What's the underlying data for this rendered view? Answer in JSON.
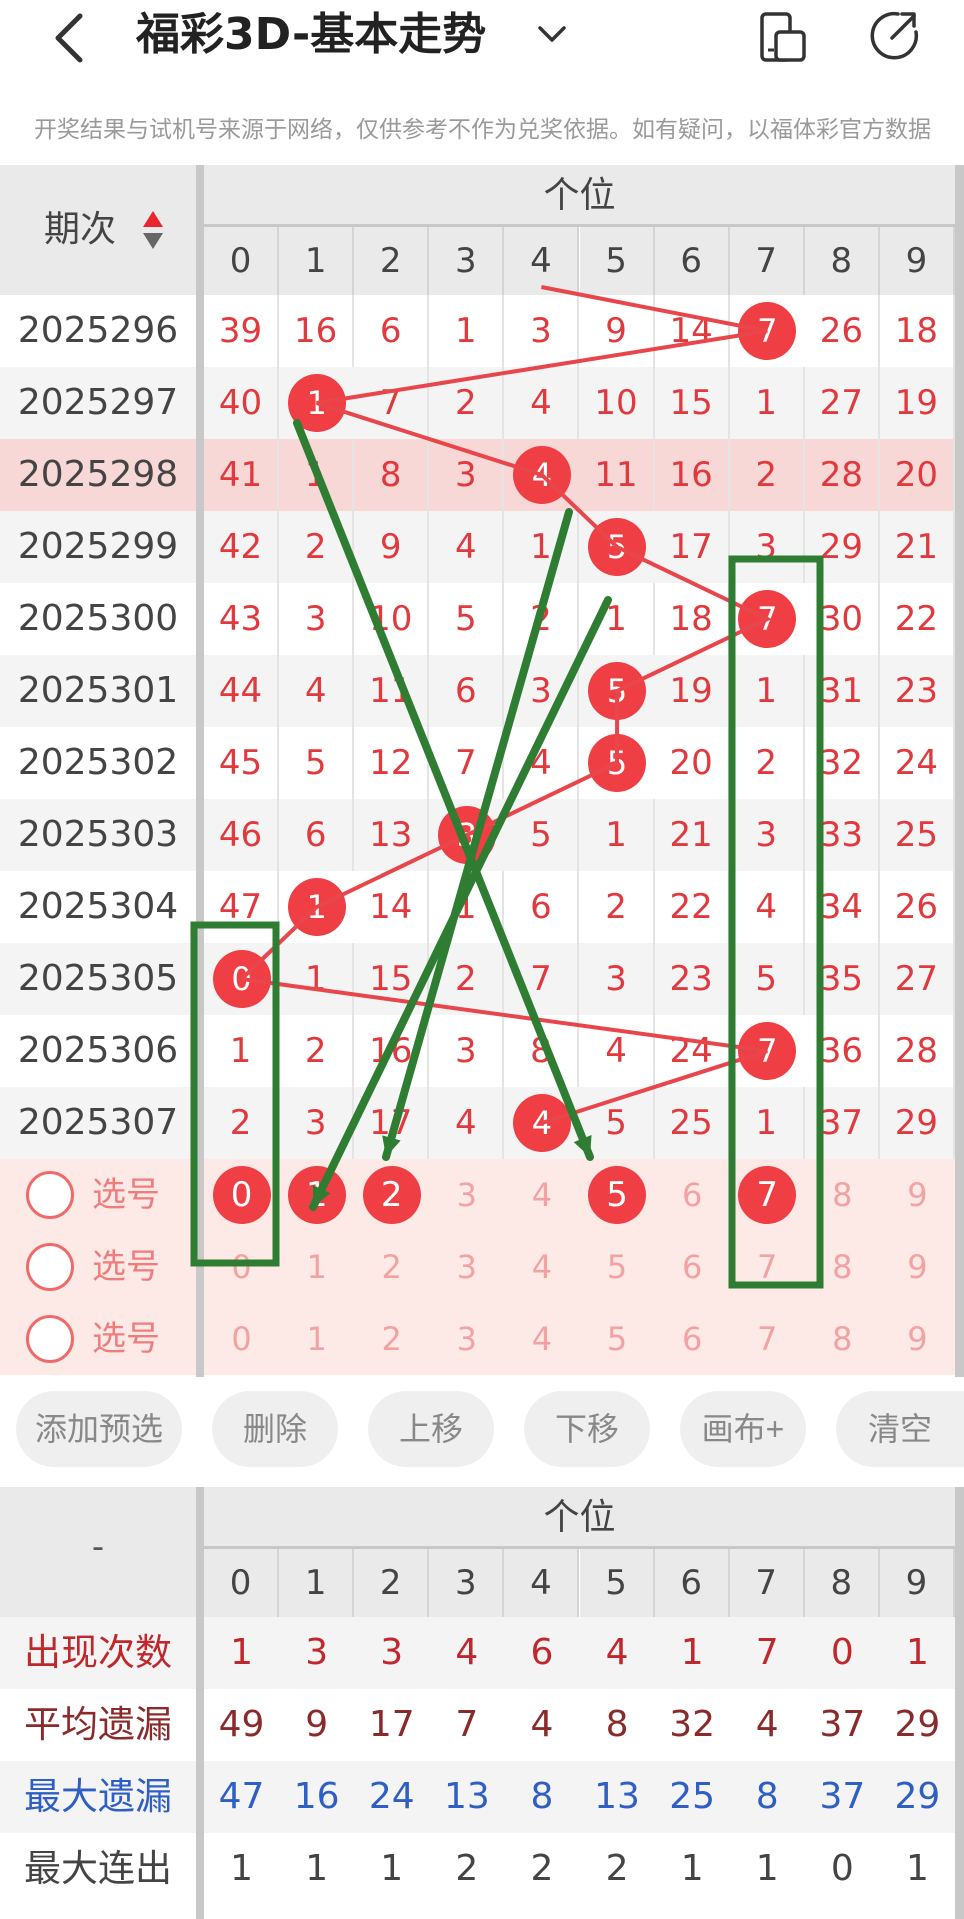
{
  "header": {
    "title": "福彩3D-基本走势",
    "back_icon": "chevron-left-icon",
    "dropdown_icon": "chevron-down-icon",
    "device_icon": "device-icon",
    "share_icon": "share-icon"
  },
  "disclaimer": "开奖结果与试机号来源于网络，仅供参考不作为兑奖依据。如有疑问，以福体彩官方数据",
  "trend": {
    "period_header": "期次",
    "group_header": "个位",
    "digits": [
      "0",
      "1",
      "2",
      "3",
      "4",
      "5",
      "6",
      "7",
      "8",
      "9"
    ],
    "rows": [
      {
        "period": "2025296",
        "winning": 7,
        "cells": [
          "39",
          "16",
          "6",
          "1",
          "3",
          "9",
          "14",
          "7",
          "26",
          "18"
        ]
      },
      {
        "period": "2025297",
        "winning": 1,
        "cells": [
          "40",
          "1",
          "7",
          "2",
          "4",
          "10",
          "15",
          "1",
          "27",
          "19"
        ]
      },
      {
        "period": "2025298",
        "winning": 4,
        "cells": [
          "41",
          "1",
          "8",
          "3",
          "4",
          "11",
          "16",
          "2",
          "28",
          "20"
        ]
      },
      {
        "period": "2025299",
        "winning": 5,
        "cells": [
          "42",
          "2",
          "9",
          "4",
          "1",
          "5",
          "17",
          "3",
          "29",
          "21"
        ]
      },
      {
        "period": "2025300",
        "winning": 7,
        "cells": [
          "43",
          "3",
          "10",
          "5",
          "2",
          "1",
          "18",
          "7",
          "30",
          "22"
        ]
      },
      {
        "period": "2025301",
        "winning": 5,
        "cells": [
          "44",
          "4",
          "11",
          "6",
          "3",
          "5",
          "19",
          "1",
          "31",
          "23"
        ]
      },
      {
        "period": "2025302",
        "winning": 5,
        "cells": [
          "45",
          "5",
          "12",
          "7",
          "4",
          "5",
          "20",
          "2",
          "32",
          "24"
        ]
      },
      {
        "period": "2025303",
        "winning": 3,
        "cells": [
          "46",
          "6",
          "13",
          "3",
          "5",
          "1",
          "21",
          "3",
          "33",
          "25"
        ]
      },
      {
        "period": "2025304",
        "winning": 1,
        "cells": [
          "47",
          "1",
          "14",
          "1",
          "6",
          "2",
          "22",
          "4",
          "34",
          "26"
        ]
      },
      {
        "period": "2025305",
        "winning": 0,
        "cells": [
          "0",
          "1",
          "15",
          "2",
          "7",
          "3",
          "23",
          "5",
          "35",
          "27"
        ]
      },
      {
        "period": "2025306",
        "winning": 7,
        "cells": [
          "1",
          "2",
          "16",
          "3",
          "8",
          "4",
          "24",
          "7",
          "36",
          "28"
        ]
      },
      {
        "period": "2025307",
        "winning": 4,
        "cells": [
          "2",
          "3",
          "17",
          "4",
          "4",
          "5",
          "25",
          "1",
          "37",
          "29"
        ]
      }
    ],
    "pick_label": "选号",
    "pick_rows": [
      {
        "selected": [
          0,
          1,
          2,
          5,
          7
        ]
      },
      {
        "selected": []
      },
      {
        "selected": []
      }
    ]
  },
  "toolbar": {
    "add": "添加预选",
    "delete": "删除",
    "move_up": "上移",
    "move_down": "下移",
    "canvas": "画布+",
    "clear": "清空"
  },
  "stats": {
    "corner": "-",
    "group_header": "个位",
    "rows": [
      {
        "label": "出现次数",
        "color": "#c0282d",
        "values": [
          "1",
          "3",
          "3",
          "4",
          "6",
          "4",
          "1",
          "7",
          "0",
          "1"
        ]
      },
      {
        "label": "平均遗漏",
        "color": "#8a2a2a",
        "values": [
          "49",
          "9",
          "17",
          "7",
          "4",
          "8",
          "32",
          "4",
          "37",
          "29"
        ]
      },
      {
        "label": "最大遗漏",
        "color": "#2f5fc4",
        "values": [
          "47",
          "16",
          "24",
          "13",
          "8",
          "13",
          "25",
          "8",
          "37",
          "29"
        ]
      },
      {
        "label": "最大连出",
        "color": "#444444",
        "values": [
          "1",
          "1",
          "1",
          "2",
          "2",
          "2",
          "1",
          "1",
          "0",
          "1"
        ]
      }
    ]
  },
  "colors": {
    "ball_red": "#ef3f44",
    "line_red": "#e8464b",
    "annotation_green": "#2e7d32",
    "highlight_row": "#f8d7d7",
    "pick_bg": "#fdeae6"
  }
}
